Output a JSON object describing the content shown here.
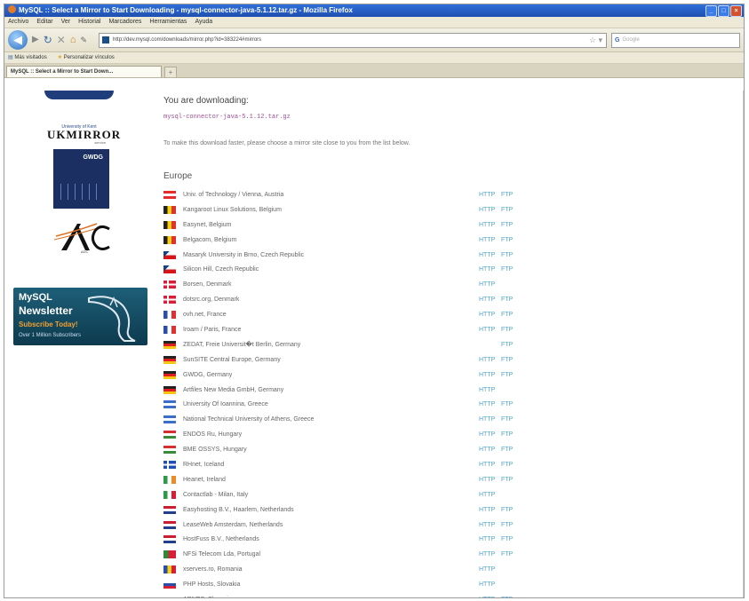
{
  "window": {
    "title": "MySQL :: Select a Mirror to Start Downloading - mysql-connector-java-5.1.12.tar.gz - Mozilla Firefox"
  },
  "menu": [
    "Archivo",
    "Editar",
    "Ver",
    "Historial",
    "Marcadores",
    "Herramientas",
    "Ayuda"
  ],
  "nav": {
    "url": "http://dev.mysql.com/downloads/mirror.php?id=383224#mirrors",
    "search_placeholder": "Google"
  },
  "bookmarks": [
    "Más visitados",
    "Personalizar vínculos"
  ],
  "tab": {
    "label": "MySQL :: Select a Mirror to Start Down..."
  },
  "sidebar": {
    "ukmirror_small": "University of Kent",
    "ukmirror_big": "UKMIRROR",
    "ukmirror_tiny": "service",
    "gwdg": "GWDG",
    "adc": "ADC",
    "newsletter": {
      "brand": "MySQL",
      "title": "Newsletter",
      "subscribe": "Subscribe Today!",
      "subscribers": "Over 1 Million Subscribers"
    }
  },
  "main": {
    "heading": "You are downloading:",
    "filename": "mysql-connector-java-5.1.12.tar.gz",
    "hint": "To make this download faster, please choose a mirror site close to you from the list below.",
    "region": "Europe",
    "mirrors": [
      {
        "name": "Univ. of Technology / Vienna, Austria",
        "http": "HTTP",
        "ftp": "FTP",
        "flag": [
          "#e32d2d",
          "#ffffff",
          "#e32d2d"
        ],
        "dir": "h"
      },
      {
        "name": "Kangaroot Linux Solutions, Belgium",
        "http": "HTTP",
        "ftp": "FTP",
        "flag": [
          "#222222",
          "#f6d20a",
          "#e03030"
        ],
        "dir": "v"
      },
      {
        "name": "Easynet, Belgium",
        "http": "HTTP",
        "ftp": "FTP",
        "flag": [
          "#222222",
          "#f6d20a",
          "#e03030"
        ],
        "dir": "v"
      },
      {
        "name": "Belgacom, Belgium",
        "http": "HTTP",
        "ftp": "FTP",
        "flag": [
          "#222222",
          "#f6d20a",
          "#e03030"
        ],
        "dir": "v"
      },
      {
        "name": "Masaryk University in Brno, Czech Republic",
        "http": "HTTP",
        "ftp": "FTP",
        "flag": [
          "#ffffff",
          "#d7141a",
          "#11457e"
        ],
        "dir": "cz"
      },
      {
        "name": "Silicon Hill, Czech Republic",
        "http": "HTTP",
        "ftp": "FTP",
        "flag": [
          "#ffffff",
          "#d7141a",
          "#11457e"
        ],
        "dir": "cz"
      },
      {
        "name": "Borsen, Denmark",
        "http": "HTTP",
        "ftp": "",
        "flag": [
          "#d6203a",
          "#ffffff"
        ],
        "dir": "cross"
      },
      {
        "name": "dotsrc.org, Denmark",
        "http": "HTTP",
        "ftp": "FTP",
        "flag": [
          "#d6203a",
          "#ffffff"
        ],
        "dir": "cross"
      },
      {
        "name": "ovh.net, France",
        "http": "HTTP",
        "ftp": "FTP",
        "flag": [
          "#2b4fa8",
          "#ffffff",
          "#e03030"
        ],
        "dir": "v"
      },
      {
        "name": "Iroam / Paris, France",
        "http": "HTTP",
        "ftp": "FTP",
        "flag": [
          "#2b4fa8",
          "#ffffff",
          "#e03030"
        ],
        "dir": "v"
      },
      {
        "name": "ZEDAT, Freie Universit�t Berlin, Germany",
        "http": "",
        "ftp": "FTP",
        "flag": [
          "#222222",
          "#dd1f1f",
          "#f7c516"
        ],
        "dir": "h"
      },
      {
        "name": "SunSITE Central Europe, Germany",
        "http": "HTTP",
        "ftp": "FTP",
        "flag": [
          "#222222",
          "#dd1f1f",
          "#f7c516"
        ],
        "dir": "h"
      },
      {
        "name": "GWDG, Germany",
        "http": "HTTP",
        "ftp": "FTP",
        "flag": [
          "#222222",
          "#dd1f1f",
          "#f7c516"
        ],
        "dir": "h"
      },
      {
        "name": "Artfiles New Media GmbH, Germany",
        "http": "HTTP",
        "ftp": "",
        "flag": [
          "#222222",
          "#dd1f1f",
          "#f7c516"
        ],
        "dir": "h"
      },
      {
        "name": "University Of Ioannina, Greece",
        "http": "HTTP",
        "ftp": "FTP",
        "flag": [
          "#3a6fc4",
          "#ffffff",
          "#3a6fc4"
        ],
        "dir": "h"
      },
      {
        "name": "National Technical University of Athens, Greece",
        "http": "HTTP",
        "ftp": "FTP",
        "flag": [
          "#3a6fc4",
          "#ffffff",
          "#3a6fc4"
        ],
        "dir": "h"
      },
      {
        "name": "ENDOS Ru, Hungary",
        "http": "HTTP",
        "ftp": "FTP",
        "flag": [
          "#d43030",
          "#ffffff",
          "#3a8a3a"
        ],
        "dir": "h"
      },
      {
        "name": "BME OSSYS, Hungary",
        "http": "HTTP",
        "ftp": "FTP",
        "flag": [
          "#d43030",
          "#ffffff",
          "#3a8a3a"
        ],
        "dir": "h"
      },
      {
        "name": "RHnet, Iceland",
        "http": "HTTP",
        "ftp": "FTP",
        "flag": [
          "#1f4fb0",
          "#ffffff",
          "#d6203a"
        ],
        "dir": "cross"
      },
      {
        "name": "Heanet, Ireland",
        "http": "HTTP",
        "ftp": "FTP",
        "flag": [
          "#2e9a45",
          "#ffffff",
          "#f08a24"
        ],
        "dir": "v"
      },
      {
        "name": "Contactlab - Milan, Italy",
        "http": "HTTP",
        "ftp": "",
        "flag": [
          "#2e9a45",
          "#ffffff",
          "#d6203a"
        ],
        "dir": "v"
      },
      {
        "name": "Easyhosting B.V., Haarlem, Netherlands",
        "http": "HTTP",
        "ftp": "FTP",
        "flag": [
          "#c8202e",
          "#ffffff",
          "#23408f"
        ],
        "dir": "h"
      },
      {
        "name": "LeaseWeb Amsterdam, Netherlands",
        "http": "HTTP",
        "ftp": "FTP",
        "flag": [
          "#c8202e",
          "#ffffff",
          "#23408f"
        ],
        "dir": "h"
      },
      {
        "name": "HostFuss B.V., Netherlands",
        "http": "HTTP",
        "ftp": "FTP",
        "flag": [
          "#c8202e",
          "#ffffff",
          "#23408f"
        ],
        "dir": "h"
      },
      {
        "name": "NFSi Telecom Lda, Portugal",
        "http": "HTTP",
        "ftp": "FTP",
        "flag": [
          "#2e8a3a",
          "#d6203a",
          "#f7c516"
        ],
        "dir": "pt"
      },
      {
        "name": "xservers.ro, Romania",
        "http": "HTTP",
        "ftp": "",
        "flag": [
          "#2b4fa8",
          "#f7d116",
          "#d6203a"
        ],
        "dir": "v"
      },
      {
        "name": "PHP Hosts, Slovakia",
        "http": "HTTP",
        "ftp": "",
        "flag": [
          "#ffffff",
          "#2b4fa8",
          "#d6203a"
        ],
        "dir": "h"
      },
      {
        "name": "ARNES, Slovenia",
        "http": "HTTP",
        "ftp": "FTP",
        "flag": [
          "#ffffff",
          "#2b4fa8",
          "#d6203a"
        ],
        "dir": "h"
      }
    ]
  },
  "colors": {
    "link": "#4fa6c9",
    "filename": "#9b4f96",
    "titlebar": "#2f6fd8"
  }
}
